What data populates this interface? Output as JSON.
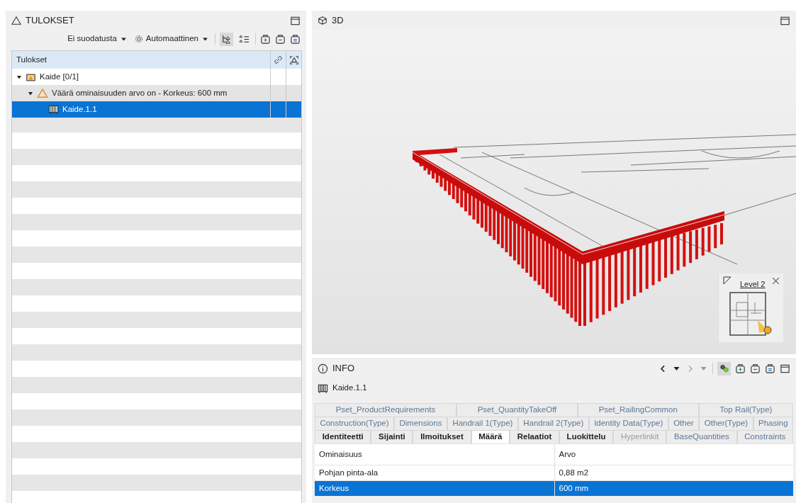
{
  "results_panel": {
    "title": "TULOKSET",
    "filter": "Ei suodatusta",
    "mode": "Automaattinen",
    "view_toggles": [
      {
        "kind": "tree",
        "selected": true
      },
      {
        "kind": "list",
        "selected": false
      }
    ],
    "tree": {
      "column": "Tulokset",
      "rows": [
        {
          "kind": "group",
          "label": "Kaide [0/1]",
          "expanded": true,
          "selected": false,
          "children": [
            {
              "kind": "issue",
              "label": "Väärä ominaisuuden arvo on - Korkeus: 600 mm",
              "expanded": true,
              "selected": false,
              "children": [
                {
                  "kind": "component",
                  "label": "Kaide.1.1",
                  "selected": true
                }
              ]
            }
          ]
        }
      ]
    }
  },
  "view_3d": {
    "title": "3D",
    "minimap": {
      "label": "Level 2"
    }
  },
  "info_panel": {
    "title": "INFO",
    "nav": [
      {
        "kind": "back",
        "disabled": false
      },
      {
        "kind": "menu",
        "disabled": false
      },
      {
        "kind": "forward",
        "disabled": true
      },
      {
        "kind": "menu",
        "disabled": true
      }
    ],
    "object": "Kaide.1.1",
    "tab_rows": [
      [
        {
          "label": "Pset_ProductRequirements",
          "kind": "ifc",
          "selected": false
        },
        {
          "label": "Pset_QuantityTakeOff",
          "kind": "ifc",
          "selected": false
        },
        {
          "label": "Pset_RailingCommon",
          "kind": "ifc",
          "selected": false
        },
        {
          "label": "Top Rail(Type)",
          "kind": "ifc",
          "selected": false
        }
      ],
      [
        {
          "label": "Construction(Type)",
          "kind": "ifc",
          "selected": false
        },
        {
          "label": "Dimensions",
          "kind": "ifc",
          "selected": false
        },
        {
          "label": "Handrail 1(Type)",
          "kind": "ifc",
          "selected": false
        },
        {
          "label": "Handrail 2(Type)",
          "kind": "ifc",
          "selected": false
        },
        {
          "label": "Identity Data(Type)",
          "kind": "ifc",
          "selected": false
        },
        {
          "label": "Other",
          "kind": "ifc",
          "selected": false
        },
        {
          "label": "Other(Type)",
          "kind": "ifc",
          "selected": false
        },
        {
          "label": "Phasing",
          "kind": "ifc",
          "selected": false
        }
      ],
      [
        {
          "label": "Identiteetti",
          "kind": "native",
          "selected": false
        },
        {
          "label": "Sijainti",
          "kind": "native",
          "selected": false
        },
        {
          "label": "Ilmoitukset",
          "kind": "native",
          "selected": false
        },
        {
          "label": "Määrä",
          "kind": "native",
          "selected": true
        },
        {
          "label": "Relaatiot",
          "kind": "native",
          "selected": false
        },
        {
          "label": "Luokittelu",
          "kind": "native",
          "selected": false
        },
        {
          "label": "Hyperlinkit",
          "kind": "disabled",
          "selected": false
        },
        {
          "label": "BaseQuantities",
          "kind": "ifc",
          "selected": false
        },
        {
          "label": "Constraints",
          "kind": "ifc",
          "selected": false
        }
      ]
    ],
    "table": {
      "columns": [
        "Ominaisuus",
        "Arvo"
      ],
      "rows": [
        {
          "cells": [
            "Pohjan pinta-ala",
            "0,88 m2"
          ],
          "selected": false
        },
        {
          "cells": [
            "Korkeus",
            "600 mm"
          ],
          "selected": true
        }
      ]
    }
  }
}
